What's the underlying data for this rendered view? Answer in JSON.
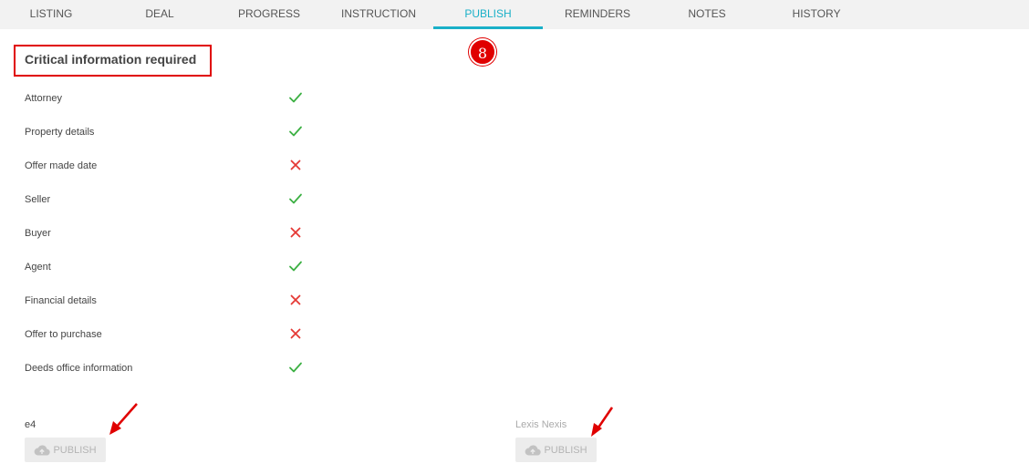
{
  "tabs": [
    {
      "label": "LISTING",
      "active": false
    },
    {
      "label": "DEAL",
      "active": false
    },
    {
      "label": "PROGRESS",
      "active": false
    },
    {
      "label": "INSTRUCTION",
      "active": false
    },
    {
      "label": "PUBLISH",
      "active": true
    },
    {
      "label": "REMINDERS",
      "active": false
    },
    {
      "label": "NOTES",
      "active": false
    },
    {
      "label": "HISTORY",
      "active": false
    }
  ],
  "step_badge": "8",
  "section": {
    "title": "Critical information required",
    "items": [
      {
        "label": "Attorney",
        "status": "complete"
      },
      {
        "label": "Property details",
        "status": "complete"
      },
      {
        "label": "Offer made date",
        "status": "missing"
      },
      {
        "label": "Seller",
        "status": "complete"
      },
      {
        "label": "Buyer",
        "status": "missing"
      },
      {
        "label": "Agent",
        "status": "complete"
      },
      {
        "label": "Financial details",
        "status": "missing"
      },
      {
        "label": "Offer to purchase",
        "status": "missing"
      },
      {
        "label": "Deeds office information",
        "status": "complete"
      }
    ]
  },
  "publishers": [
    {
      "name": "e4",
      "button_label": "PUBLISH",
      "icon": "cloud-upload-icon",
      "enabled": false
    },
    {
      "name": "Lexis Nexis",
      "button_label": "PUBLISH",
      "icon": "cloud-upload-icon",
      "enabled": false
    }
  ],
  "colors": {
    "accent": "#1ab0c8",
    "check": "#3cb043",
    "cross": "#e53935",
    "annotation": "#e00000"
  }
}
